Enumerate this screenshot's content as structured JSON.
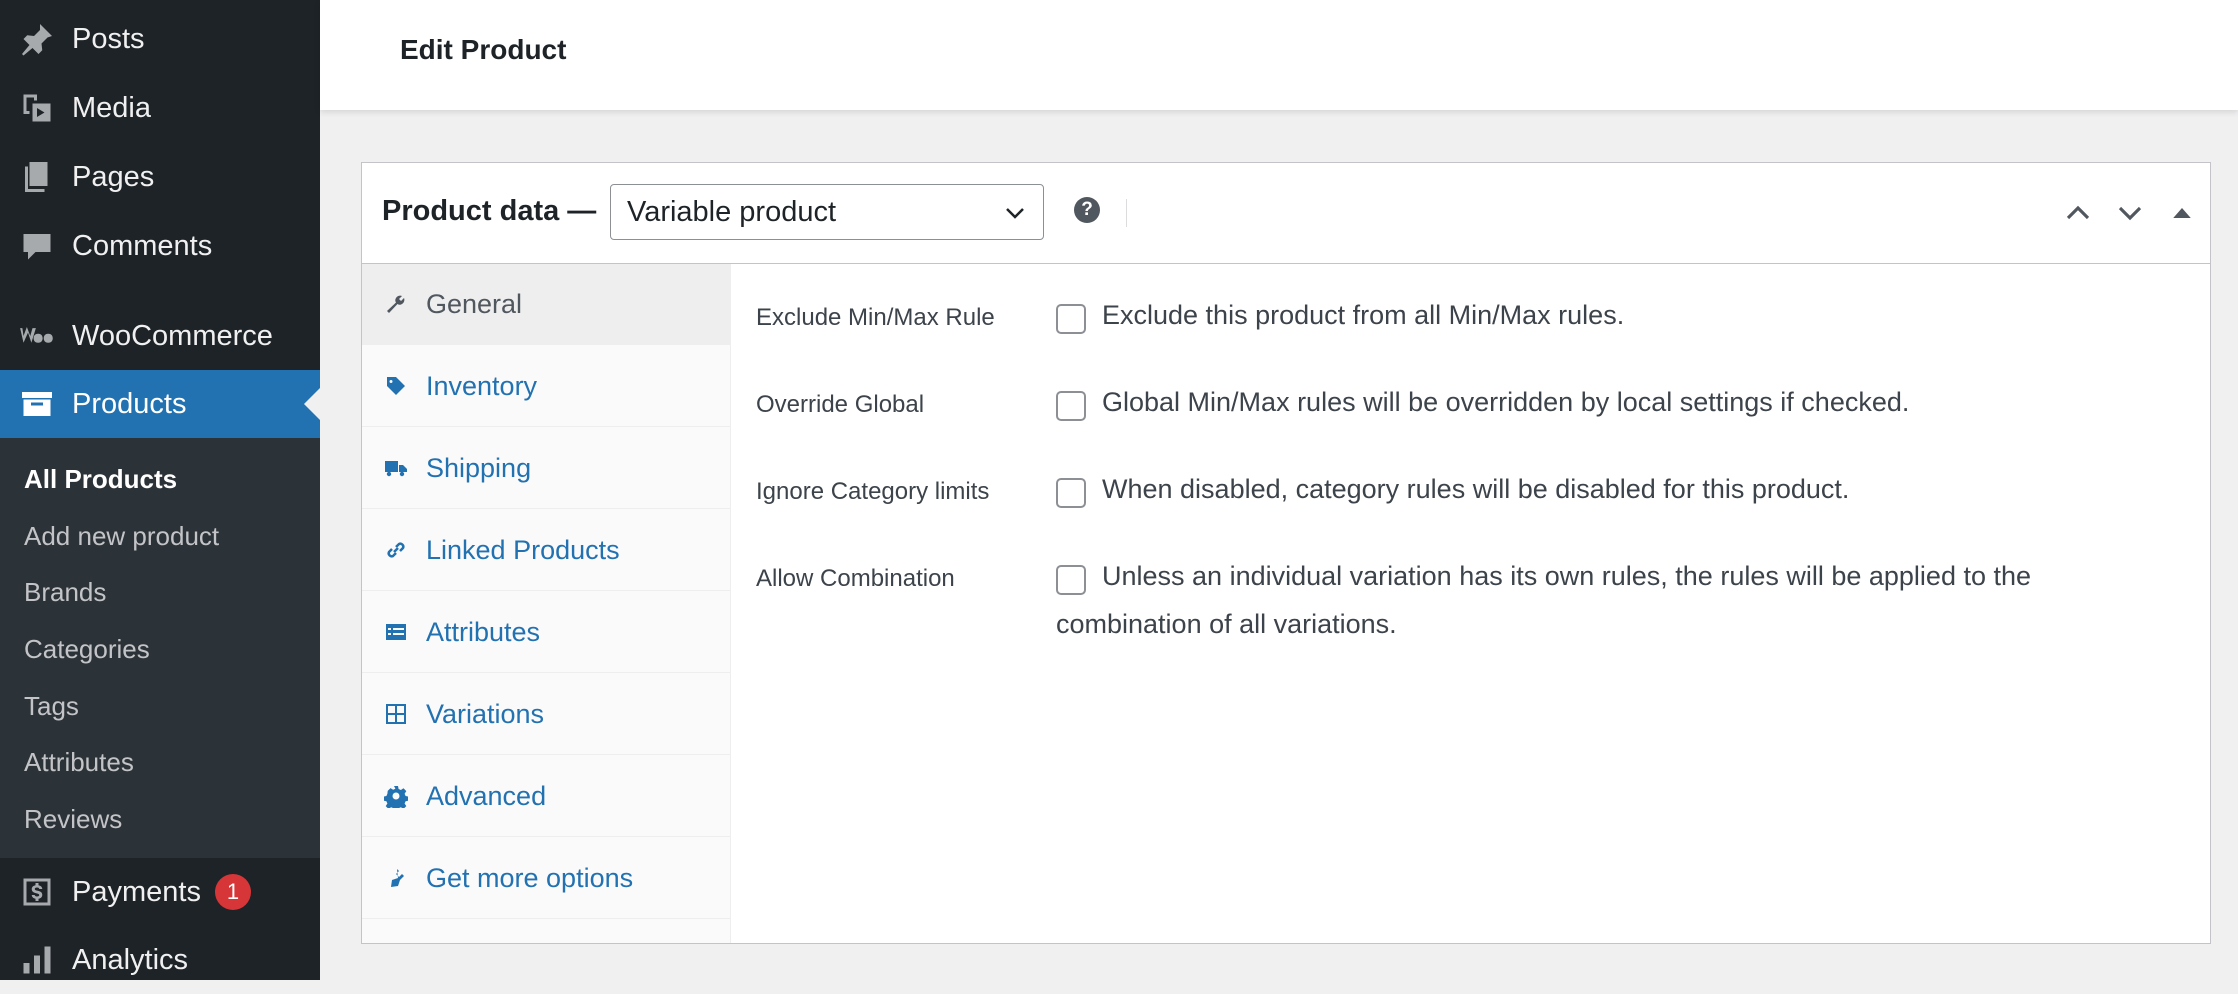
{
  "sidebar": {
    "menu": [
      {
        "label": "Posts",
        "icon": "pin-icon"
      },
      {
        "label": "Media",
        "icon": "media-icon"
      },
      {
        "label": "Pages",
        "icon": "pages-icon"
      },
      {
        "label": "Comments",
        "icon": "comment-icon"
      },
      {
        "label": "WooCommerce",
        "icon": "woocommerce-icon"
      },
      {
        "label": "Products",
        "icon": "archive-icon",
        "active": true
      },
      {
        "label": "Payments",
        "icon": "dollar-icon",
        "badge": "1"
      },
      {
        "label": "Analytics",
        "icon": "bar-chart-icon"
      }
    ],
    "submenu": [
      {
        "label": "All Products",
        "current": true
      },
      {
        "label": "Add new product"
      },
      {
        "label": "Brands"
      },
      {
        "label": "Categories"
      },
      {
        "label": "Tags"
      },
      {
        "label": "Attributes"
      },
      {
        "label": "Reviews"
      }
    ]
  },
  "header": {
    "title": "Edit Product"
  },
  "product_data": {
    "title": "Product data —",
    "type_select": {
      "value": "Variable product"
    },
    "help_icon": "?",
    "tabs": [
      {
        "label": "General",
        "icon": "wrench-icon",
        "active": true
      },
      {
        "label": "Inventory",
        "icon": "tag-icon"
      },
      {
        "label": "Shipping",
        "icon": "truck-icon"
      },
      {
        "label": "Linked Products",
        "icon": "link-icon"
      },
      {
        "label": "Attributes",
        "icon": "list-icon"
      },
      {
        "label": "Variations",
        "icon": "grid-icon"
      },
      {
        "label": "Advanced",
        "icon": "gear-icon"
      },
      {
        "label": "Get more options",
        "icon": "plugin-icon"
      }
    ],
    "options": [
      {
        "label": "Exclude Min/Max Rule",
        "checked": false,
        "description": "Exclude this product from all Min/Max rules."
      },
      {
        "label": "Override Global",
        "checked": false,
        "description": "Global Min/Max rules will be overridden by local settings if checked."
      },
      {
        "label": "Ignore Category limits",
        "checked": false,
        "description": "When disabled, category rules will be disabled for this product."
      },
      {
        "label": "Allow Combination",
        "checked": false,
        "description": "Unless an individual variation has its own rules, the rules will be applied to the combination of all variations."
      }
    ]
  },
  "colors": {
    "sidebar_bg": "#1d2327",
    "submenu_bg": "#2c3338",
    "accent": "#2271b1",
    "badge": "#d63638",
    "page_bg": "#f0f0f1"
  }
}
